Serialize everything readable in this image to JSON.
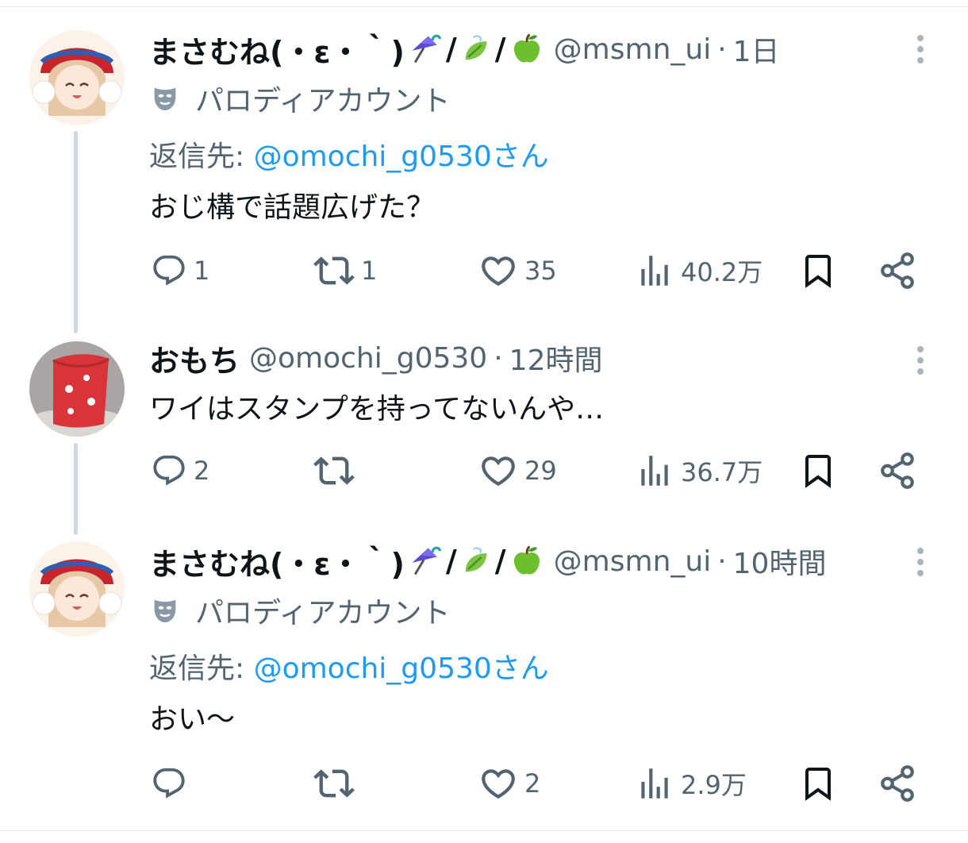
{
  "tweets": [
    {
      "name": "まさむね(・ε・｀)",
      "emoji": [
        "umbrella-emoji",
        "leaf-emoji",
        "green-apple-emoji"
      ],
      "handle": "@msmn_ui",
      "separator": "·",
      "time": "1日",
      "parody_label": "パロディアカウント",
      "reply_prefix": "返信先: ",
      "reply_to": "@omochi_g0530さん",
      "text": "おじ構で話題広げた？",
      "replies": "1",
      "retweets": "1",
      "likes": "35",
      "views": "40.2万"
    },
    {
      "name": "おもち",
      "handle": "@omochi_g0530",
      "separator": "·",
      "time": "12時間",
      "text": "ワイはスタンプを持ってないんや…",
      "replies": "2",
      "retweets": "",
      "likes": "29",
      "views": "36.7万"
    },
    {
      "name": "まさむね(・ε・｀)",
      "emoji": [
        "umbrella-emoji",
        "leaf-emoji",
        "green-apple-emoji"
      ],
      "handle": "@msmn_ui",
      "separator": "·",
      "time": "10時間",
      "parody_label": "パロディアカウント",
      "reply_prefix": "返信先: ",
      "reply_to": "@omochi_g0530さん",
      "text": "おい〜",
      "replies": "",
      "retweets": "",
      "likes": "2",
      "views": "2.9万"
    }
  ],
  "colors": {
    "link": "#1d9bf0",
    "secondary": "#536471",
    "primary": "#0f1419",
    "thread": "#cfd9de"
  },
  "icons": [
    "reply-icon",
    "retweet-icon",
    "like-icon",
    "views-icon",
    "bookmark-icon",
    "share-icon",
    "more-icon",
    "parody-mask-icon"
  ]
}
